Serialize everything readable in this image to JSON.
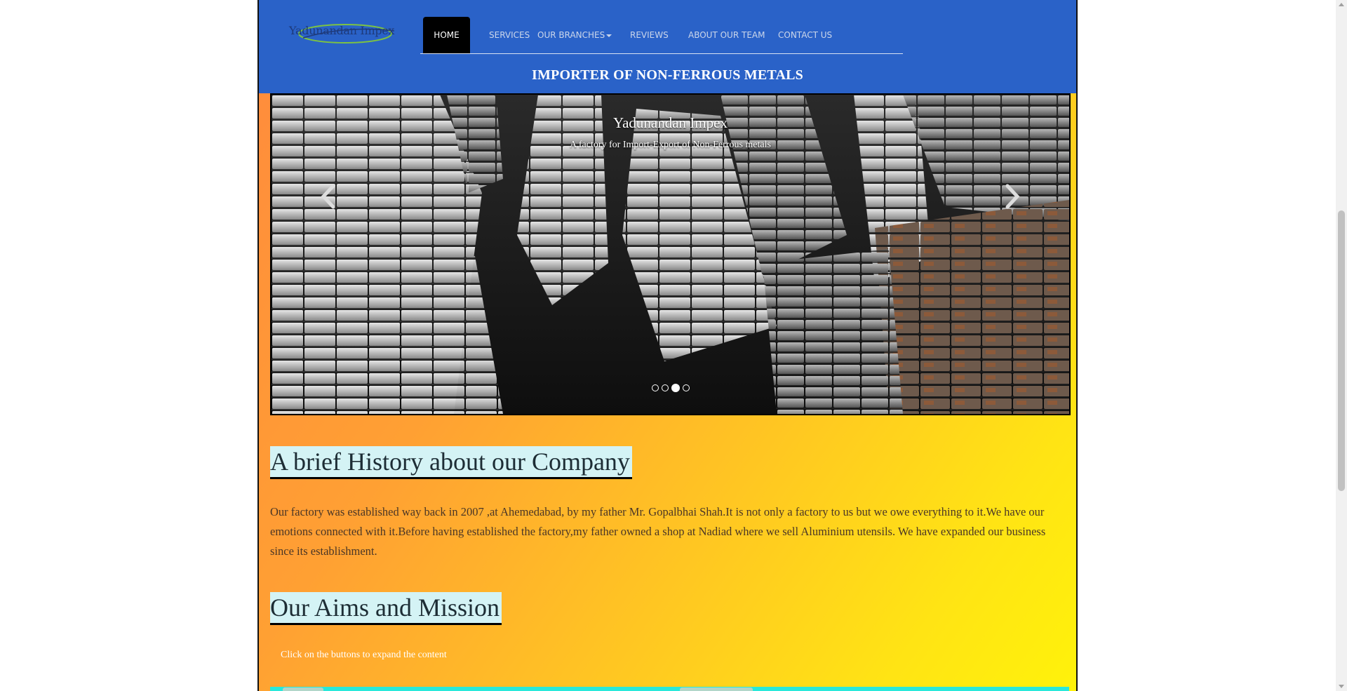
{
  "logo": {
    "text": "Yadunandan Impex"
  },
  "nav": {
    "items": [
      {
        "label": "HOME",
        "active": true
      },
      {
        "label": "SERVICES"
      },
      {
        "label": "OUR BRANCHES"
      },
      {
        "label": "REVIEWS"
      },
      {
        "label": "ABOUT OUR TEAM"
      },
      {
        "label": "CONTACT US"
      }
    ]
  },
  "tagline": "IMPORTER OF NON-FERROUS METALS",
  "carousel": {
    "title": "Yadunandan Impex",
    "subtitle": "A factory for Import-Export of Non-Ferrous metals",
    "active_index": 2,
    "slide_count": 4
  },
  "history": {
    "heading": "A brief History about our Company",
    "text": "Our factory was established way back in 2007 ,at Ahemedabad, by my father Mr. Gopalbhai Shah.It is not only a factory to us but we owe everything to it.We have our emotions connected with it.Before having established the factory,my father owned a shop at Nadiad where we sell Aluminium utensils. We have expanded our business since its establishment."
  },
  "aims": {
    "heading": "Our Aims and Mission",
    "hint": "Click on the buttons to expand the content"
  },
  "colors": {
    "navbar": "#2a62c8",
    "heading_bg": "#d4f3f5",
    "gradient_start": "#ff8a3d",
    "gradient_end": "#fff20a",
    "accent_bar": "#29e8da"
  }
}
